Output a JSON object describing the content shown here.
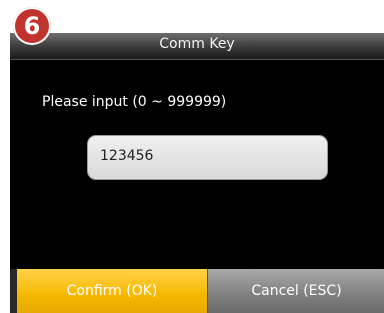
{
  "step": {
    "number": "6"
  },
  "window": {
    "title": "Comm Key"
  },
  "form": {
    "prompt": "Please input (0 ~ 999999)",
    "value": "123456"
  },
  "buttons": {
    "confirm": "Confirm (OK)",
    "cancel": "Cancel (ESC)"
  },
  "colors": {
    "confirm_button": "#f5b800",
    "cancel_button": "#7f7f7f",
    "badge": "#c1332e",
    "background": "#000000"
  }
}
